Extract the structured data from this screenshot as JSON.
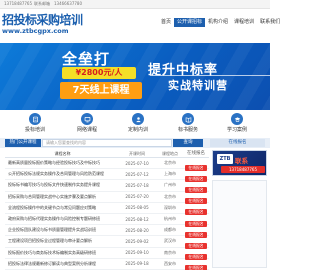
{
  "topbar": {
    "phone1": "13718487765",
    "email": "联系邮箱",
    "phone2": "13466637780"
  },
  "header": {
    "logo_text": "招投标采购培训",
    "logo_url": "www.ztbcgpx.com",
    "nav": [
      "首页",
      "公开课招标",
      "机构介绍",
      "课程培训",
      "联系我们",
      "网站地图"
    ]
  },
  "banner": {
    "title": "全垒打",
    "price": "¥2800元/人",
    "course": "7天线上课程",
    "headline1": "提升中标率",
    "headline2": "实战特训营"
  },
  "icons": [
    {
      "name": "bid-icon",
      "label": "投标培训"
    },
    {
      "name": "online-icon",
      "label": "网络课程"
    },
    {
      "name": "custom-icon",
      "label": "定制内训"
    },
    {
      "name": "book-icon",
      "label": "标书服务"
    },
    {
      "name": "study-icon",
      "label": "学习案例"
    }
  ],
  "search": {
    "left_label": "热门公开课程",
    "placeholder": "请输入您要查找的内容",
    "button": "查询",
    "right_label": "在线报名"
  },
  "table": {
    "headers": [
      "课程名称",
      "开课时间",
      "课程地点",
      "在线报名"
    ],
    "rows": [
      {
        "title": "最新高质量投标报价策略与经验投标技巧及中标技巧",
        "date": "2025-07-10",
        "region": "北京市",
        "status": "在线报名"
      },
      {
        "title": "公开招标投标法规实务操作及合同管理与风险防范课程",
        "date": "2025-07-12",
        "region": "上海市",
        "status": "在线报名"
      },
      {
        "title": "投标标书编写技巧与投标文件快速制作实务提升课程",
        "date": "2025-07-18",
        "region": "广州市",
        "status": "在线报名"
      },
      {
        "title": "招标采购与合同管理实战中心实施步骤及要点解析",
        "date": "2025-07-20",
        "region": "北京市",
        "status": "在线报名"
      },
      {
        "title": "全流程投标操作中的关键节点与常见问题应对策略",
        "date": "2025-08-05",
        "region": "深圳市",
        "status": "在线报名"
      },
      {
        "title": "政府采购与招标代理实务操作与风险控制专题研修班",
        "date": "2025-08-12",
        "region": "杭州市",
        "status": "在线报名"
      },
      {
        "title": "企业投标团队建设与标书质量管理提升实战培训班",
        "date": "2025-08-20",
        "region": "成都市",
        "status": "在线报名"
      },
      {
        "title": "工程建设项目招投标全过程管理与审计要点解析",
        "date": "2025-09-02",
        "region": "武汉市",
        "status": "在线报名"
      },
      {
        "title": "投标报价技巧与商务标技术标编制实务高级研修班",
        "date": "2025-09-10",
        "region": "南京市",
        "status": "在线报名"
      },
      {
        "title": "招投标法律法规最新修订解读与典型案例分析课程",
        "date": "2025-09-18",
        "region": "西安市",
        "status": "在线报名"
      }
    ]
  },
  "ad": {
    "logo": "ZTB",
    "title": "联系",
    "phone": "13718487765"
  },
  "colors": {
    "brand_blue": "#1d5fae",
    "status_red": "#e8322e",
    "price_yellow": "#f4df27",
    "course_orange": "#ff9e12"
  }
}
